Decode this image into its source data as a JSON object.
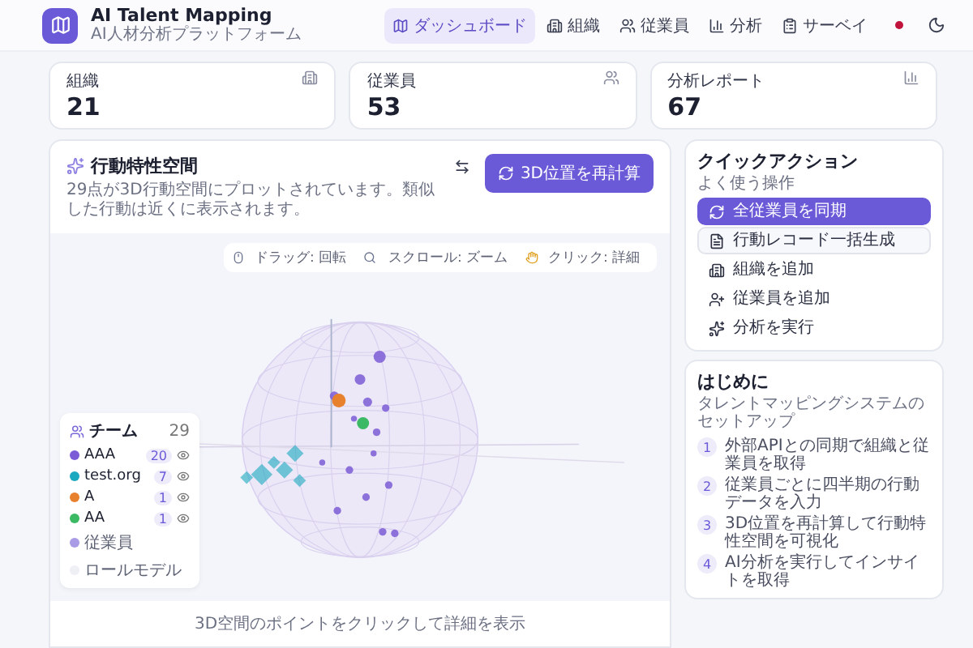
{
  "app": {
    "title": "AI Talent Mapping",
    "subtitle": "AI人材分析プラットフォーム"
  },
  "nav": [
    {
      "label": "ダッシュボード",
      "selected": true
    },
    {
      "label": "組織",
      "selected": false
    },
    {
      "label": "従業員",
      "selected": false
    },
    {
      "label": "分析",
      "selected": false
    },
    {
      "label": "サーベイ",
      "selected": false
    }
  ],
  "stats": [
    {
      "label": "組織",
      "value": "21"
    },
    {
      "label": "従業員",
      "value": "53"
    },
    {
      "label": "分析レポート",
      "value": "67"
    }
  ],
  "space": {
    "title": "行動特性空間",
    "subtitle": "29点が3D行動空間にプロットされています。類似した行動は近くに表示されます。",
    "recalc_button": "3D位置を再計算",
    "hints": [
      "ドラッグ: 回転",
      "スクロール: ズーム",
      "クリック: 詳細"
    ],
    "legend": {
      "title": "チーム",
      "count": "29",
      "teams": [
        {
          "name": "AAA",
          "count": "20",
          "color": "#7c5cd6"
        },
        {
          "name": "test.org",
          "count": "7",
          "color": "#1aa9bf"
        },
        {
          "name": "A",
          "count": "1",
          "color": "#e8812d"
        },
        {
          "name": "AA",
          "count": "1",
          "color": "#3cb964"
        }
      ],
      "markers": [
        "従業員",
        "ロールモデル"
      ]
    },
    "footer": "3D空間のポイントをクリックして詳細を表示"
  },
  "quick_actions": {
    "title": "クイックアクション",
    "subtitle": "よく使う操作",
    "items": [
      {
        "label": "全従業員を同期",
        "kind": "primary"
      },
      {
        "label": "行動レコード一括生成",
        "kind": "outline"
      },
      {
        "label": "組織を追加",
        "kind": "plain"
      },
      {
        "label": "従業員を追加",
        "kind": "plain"
      },
      {
        "label": "分析を実行",
        "kind": "plain"
      }
    ]
  },
  "getting_started": {
    "title": "はじめに",
    "subtitle": "タレントマッピングシステムのセットアップ",
    "steps": [
      {
        "number": "1",
        "text": "外部APIとの同期で組織と従業員を取得"
      },
      {
        "number": "2",
        "text": "従業員ごとに四半期の行動データを入力"
      },
      {
        "number": "3",
        "text": "3D位置を再計算して行動特性空間を可視化"
      },
      {
        "number": "4",
        "text": "AI分析を実行してインサイトを取得"
      }
    ]
  }
}
